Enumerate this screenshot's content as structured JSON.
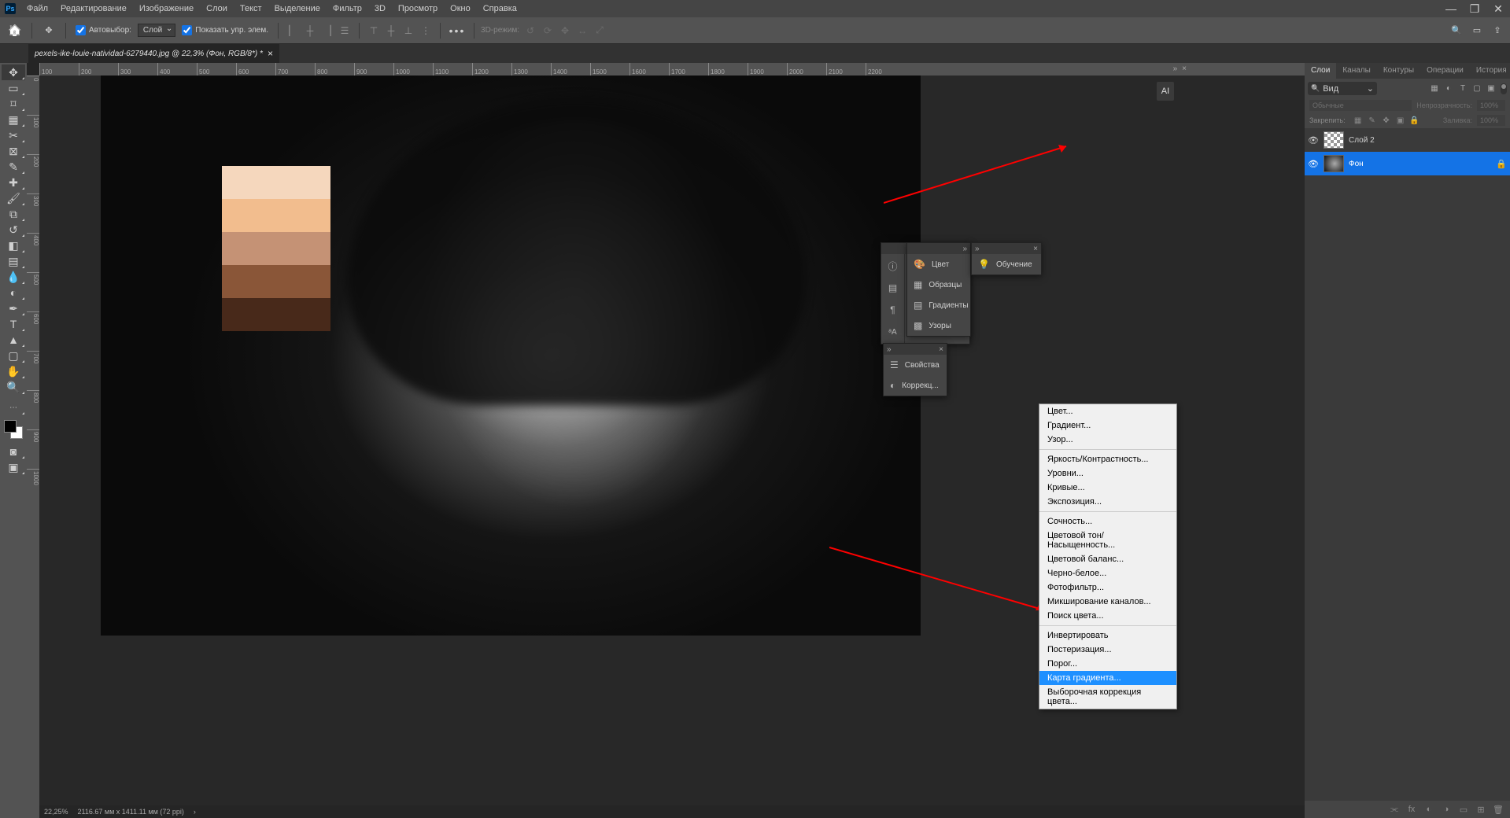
{
  "menubar": {
    "items": [
      "Файл",
      "Редактирование",
      "Изображение",
      "Слои",
      "Текст",
      "Выделение",
      "Фильтр",
      "3D",
      "Просмотр",
      "Окно",
      "Справка"
    ]
  },
  "options_bar": {
    "auto_select": "Автовыбор:",
    "auto_select_mode": "Слой",
    "show_transform": "Показать упр. элем.",
    "mode_3d": "3D-режим:"
  },
  "doc_tab": {
    "title": "pexels-ike-louie-natividad-6279440.jpg @ 22,3% (Фон, RGB/8*) *"
  },
  "ruler_h": [
    "100",
    "200",
    "300",
    "400",
    "500",
    "600",
    "700",
    "800",
    "900",
    "1000",
    "1100",
    "1200",
    "1300",
    "1400",
    "1500",
    "1600",
    "1700",
    "1800",
    "1900",
    "2000",
    "2100",
    "2200"
  ],
  "ruler_v": [
    "0",
    "100",
    "200",
    "300",
    "400",
    "500",
    "600",
    "700",
    "800",
    "900",
    "1000"
  ],
  "ai_badge": "AI",
  "statusbar": {
    "zoom": "22,25%",
    "size": "2116.67 мм x 1411.11 мм (72 ppi)"
  },
  "dock_tabs": [
    "Слои",
    "Каналы",
    "Контуры",
    "Операции",
    "История"
  ],
  "layers_header": {
    "search_mode": "Вид"
  },
  "blend_row": {
    "mode": "Обычные",
    "opacity_label": "Непрозрачность:",
    "opacity": "100%"
  },
  "lock_row": {
    "label": "Закрепить:",
    "fill_label": "Заливка:",
    "fill": "100%"
  },
  "layers": [
    {
      "name": "Слой 2",
      "locked": false,
      "checker": true
    },
    {
      "name": "Фон",
      "locked": true,
      "checker": false
    }
  ],
  "panel_color": {
    "items": [
      "Цвет",
      "Образцы",
      "Градиенты",
      "Узоры"
    ]
  },
  "panel_learn": {
    "item": "Обучение"
  },
  "panel_props": {
    "items": [
      "Свойства",
      "Коррекц..."
    ]
  },
  "context_menu": {
    "groups": [
      [
        "Цвет...",
        "Градиент...",
        "Узор..."
      ],
      [
        "Яркость/Контрастность...",
        "Уровни...",
        "Кривые...",
        "Экспозиция..."
      ],
      [
        "Сочность...",
        "Цветовой тон/Насыщенность...",
        "Цветовой баланс...",
        "Черно-белое...",
        "Фотофильтр...",
        "Микширование каналов...",
        "Поиск цвета..."
      ],
      [
        "Инвертировать",
        "Постеризация...",
        "Порог...",
        "Карта градиента...",
        "Выборочная коррекция цвета..."
      ]
    ],
    "selected": "Карта градиента..."
  }
}
